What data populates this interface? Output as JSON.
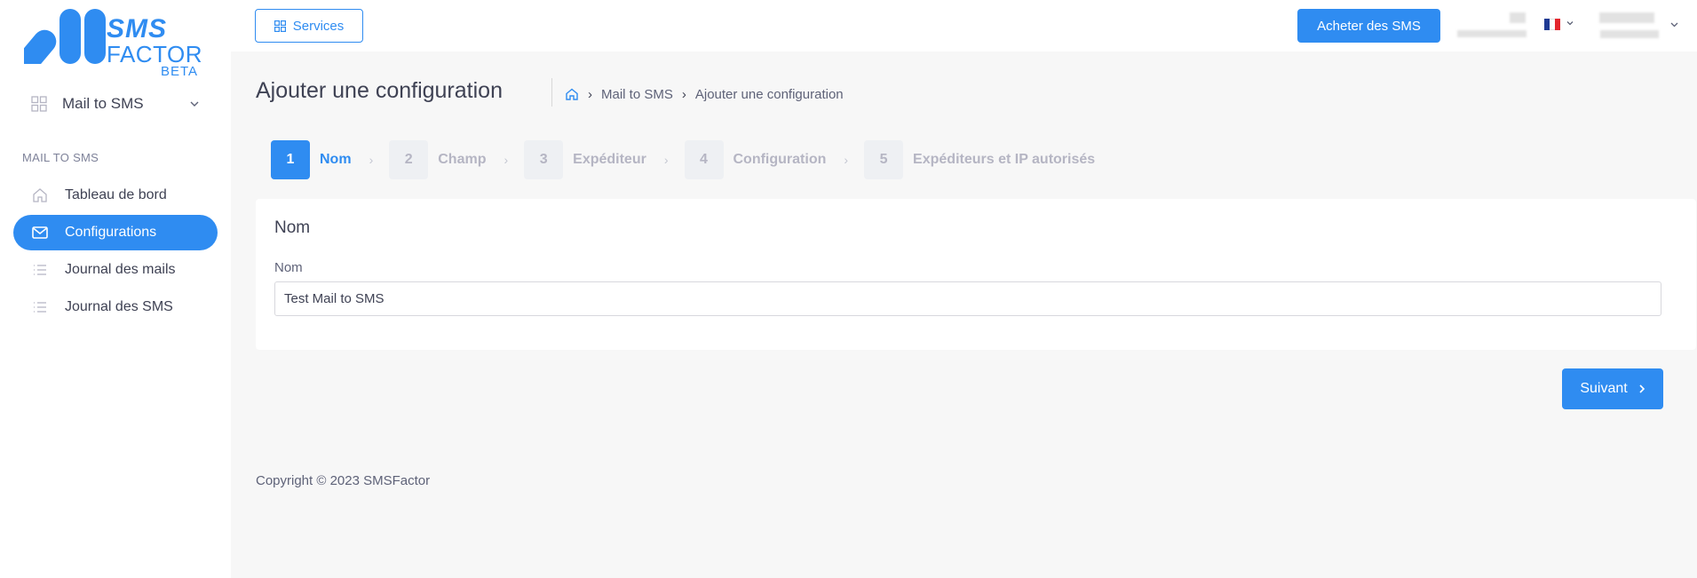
{
  "brand": {
    "logo_line1": "SMS",
    "logo_line2": "FACTOR",
    "badge": "BETA",
    "accent_color": "#2f8cf1"
  },
  "sidebar": {
    "module_selector": {
      "label": "Mail to SMS",
      "icon": "grid-icon"
    },
    "section_title": "MAIL TO SMS",
    "items": [
      {
        "label": "Tableau de bord",
        "icon": "home-icon",
        "active": false
      },
      {
        "label": "Configurations",
        "icon": "mail-icon",
        "active": true
      },
      {
        "label": "Journal des mails",
        "icon": "list-icon",
        "active": false
      },
      {
        "label": "Journal des SMS",
        "icon": "list-icon",
        "active": false
      }
    ]
  },
  "topbar": {
    "services_label": "Services",
    "buy_label": "Acheter des SMS",
    "language_flag": "flag-fr-icon"
  },
  "page": {
    "title": "Ajouter une configuration",
    "breadcrumb": [
      "Mail to SMS",
      "Ajouter une configuration"
    ]
  },
  "stepper": {
    "steps": [
      {
        "number": "1",
        "label": "Nom",
        "active": true
      },
      {
        "number": "2",
        "label": "Champ",
        "active": false
      },
      {
        "number": "3",
        "label": "Expéditeur",
        "active": false
      },
      {
        "number": "4",
        "label": "Configuration",
        "active": false
      },
      {
        "number": "5",
        "label": "Expéditeurs et IP autorisés",
        "active": false
      }
    ]
  },
  "form": {
    "card_title": "Nom",
    "name_label": "Nom",
    "name_value": "Test Mail to SMS"
  },
  "actions": {
    "next_label": "Suivant"
  },
  "footer": {
    "copyright": "Copyright © 2023 SMSFactor"
  }
}
